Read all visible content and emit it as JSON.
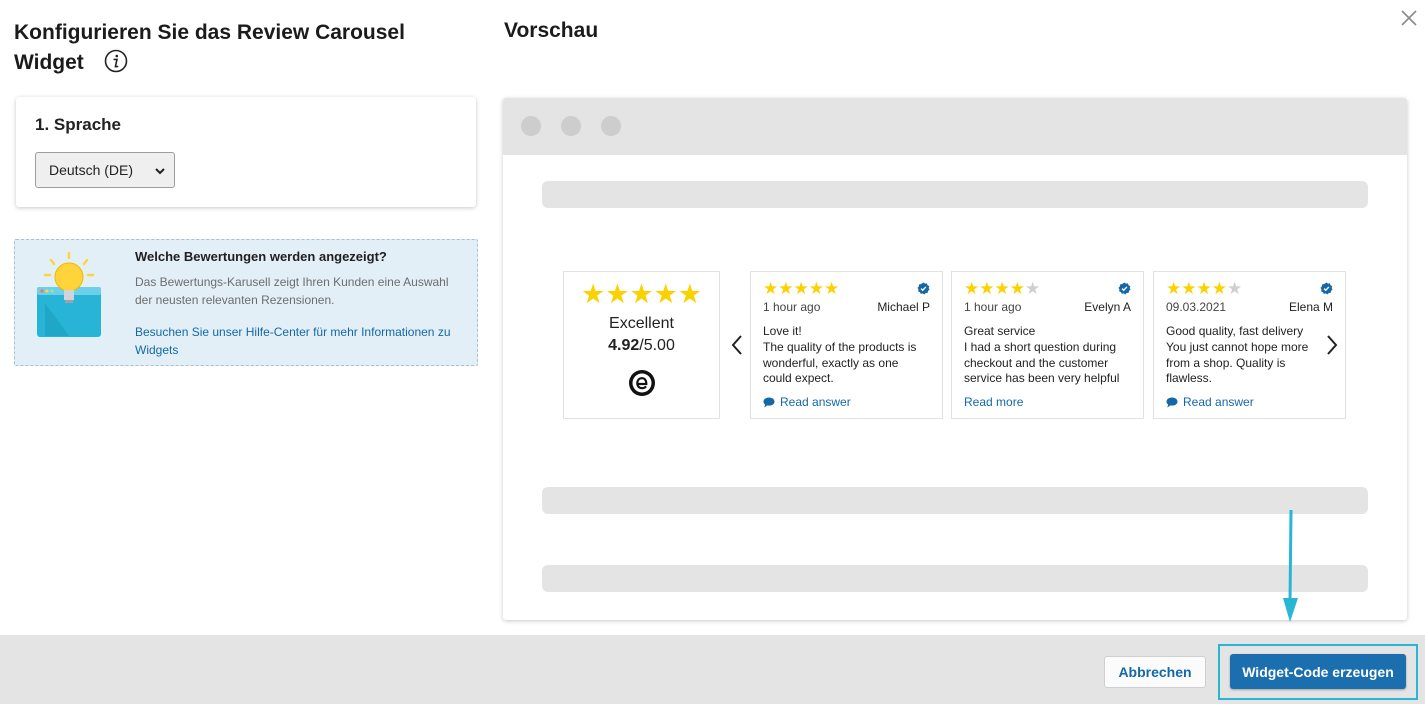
{
  "dialog": {
    "title": "Konfigurieren Sie das Review Carousel Widget",
    "preview_title": "Vorschau"
  },
  "language": {
    "heading": "1. Sprache",
    "selected": "Deutsch (DE)"
  },
  "help": {
    "title": "Welche Bewertungen werden angezeigt?",
    "text": "Das Bewertungs-Karusell zeigt Ihren Kunden eine Auswahl der neusten relevanten Rezensionen.",
    "link": "Besuchen Sie unser Hilfe-Center für mehr Informationen zu Widgets"
  },
  "summary": {
    "stars": "★★★★★",
    "label": "Excellent",
    "score": "4.92",
    "max": "/5.00",
    "logo_icon": "trusted-shops-logo"
  },
  "reviews": [
    {
      "stars_on": "★★★★★",
      "stars_off": "",
      "date": "1 hour ago",
      "author": "Michael P",
      "lines": [
        "Love it!",
        "The quality of the products is",
        "wonderful, exactly as one",
        "could expect."
      ],
      "link": "Read answer"
    },
    {
      "stars_on": "★★★★",
      "stars_off": "★",
      "date": "1 hour ago",
      "author": "Evelyn A",
      "lines": [
        "Great service",
        "I had a short question during",
        "checkout and the customer",
        "service has been very helpful"
      ],
      "link": "Read more"
    },
    {
      "stars_on": "★★★★",
      "stars_off": "★",
      "date": "09.03.2021",
      "author": "Elena M",
      "lines": [
        "Good quality, fast delivery",
        "You just cannot hope more",
        "from a shop. Quality is",
        "flawless."
      ],
      "link": "Read answer"
    }
  ],
  "footer": {
    "cancel_label": "Abbrechen",
    "generate_label": "Widget-Code erzeugen"
  },
  "colors": {
    "star": "#fcd100",
    "primary_button": "#1c6fae",
    "highlight": "#28b6d4",
    "link": "#1468a6"
  }
}
